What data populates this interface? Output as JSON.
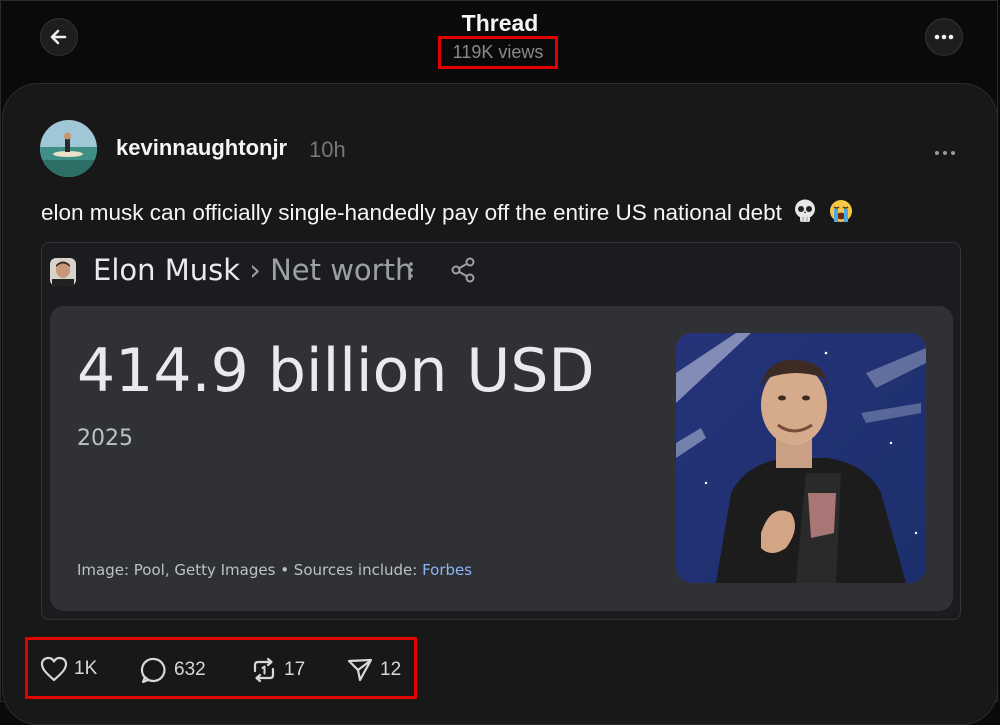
{
  "header": {
    "title": "Thread",
    "views": "119K views",
    "back_icon": "arrow-left-icon",
    "more_icon": "more-horizontal-icon"
  },
  "post": {
    "username": "kevinnaughtonjr",
    "time_ago": "10h",
    "text": "elon musk can officially single-handedly pay off the entire US national debt",
    "emojis": [
      "skull-emoji",
      "loudly-crying-emoji"
    ]
  },
  "embed": {
    "entity": "Elon Musk",
    "separator": "›",
    "attribute": "Net worth",
    "value": "414.9 billion USD",
    "year": "2025",
    "credit_prefix": "Image: Pool, Getty Images • Sources include: ",
    "credit_link": "Forbes"
  },
  "actions": {
    "likes": "1K",
    "replies": "632",
    "reposts": "17",
    "shares": "12"
  },
  "colors": {
    "background": "#0a0a0a",
    "card": "#181818",
    "highlight": "#e30000",
    "link": "#8ab4f8"
  }
}
